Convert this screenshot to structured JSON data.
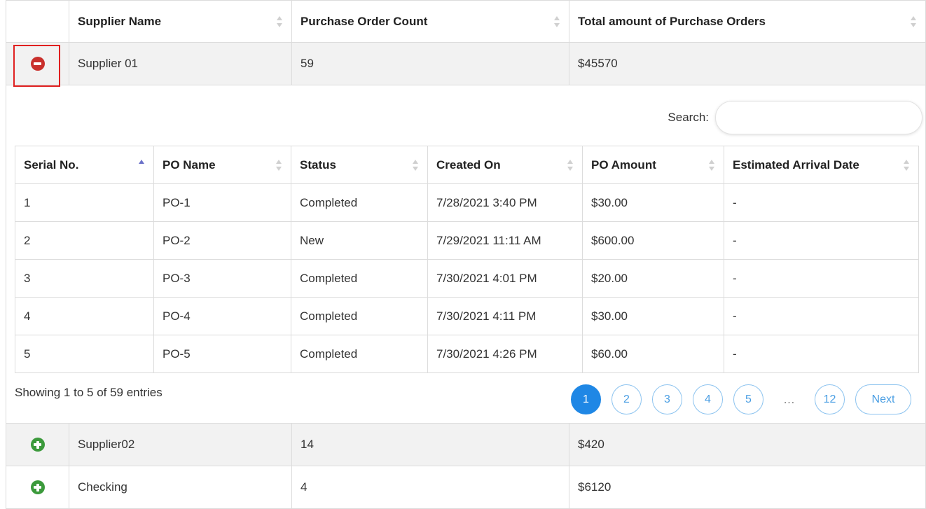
{
  "outer": {
    "headers": [
      "Supplier Name",
      "Purchase Order Count",
      "Total amount of Purchase Orders"
    ],
    "rows": [
      {
        "name": "Supplier 01",
        "count": "59",
        "total": "$45570",
        "expanded": true
      },
      {
        "name": "Supplier02",
        "count": "14",
        "total": "$420",
        "expanded": false
      },
      {
        "name": "Checking",
        "count": "4",
        "total": "$6120",
        "expanded": false
      }
    ]
  },
  "detail": {
    "search_label": "Search:",
    "search_value": "",
    "headers": [
      "Serial No.",
      "PO Name",
      "Status",
      "Created On",
      "PO Amount",
      "Estimated Arrival Date"
    ],
    "rows": [
      [
        "1",
        "PO-1",
        "Completed",
        "7/28/2021 3:40 PM",
        "$30.00",
        "-"
      ],
      [
        "2",
        "PO-2",
        "New",
        "7/29/2021 11:11 AM",
        "$600.00",
        "-"
      ],
      [
        "3",
        "PO-3",
        "Completed",
        "7/30/2021 4:01 PM",
        "$20.00",
        "-"
      ],
      [
        "4",
        "PO-4",
        "Completed",
        "7/30/2021 4:11 PM",
        "$30.00",
        "-"
      ],
      [
        "5",
        "PO-5",
        "Completed",
        "7/30/2021 4:26 PM",
        "$60.00",
        "-"
      ]
    ],
    "info": "Showing 1 to 5 of 59 entries",
    "pager": {
      "pages": [
        "1",
        "2",
        "3",
        "4",
        "5"
      ],
      "ellipsis": "…",
      "last": "12",
      "next": "Next",
      "current": "1"
    }
  },
  "colors": {
    "accent": "#1f87e5",
    "collapse": "#c9302c",
    "expand": "#3c9a3c",
    "highlight": "#e02020"
  }
}
